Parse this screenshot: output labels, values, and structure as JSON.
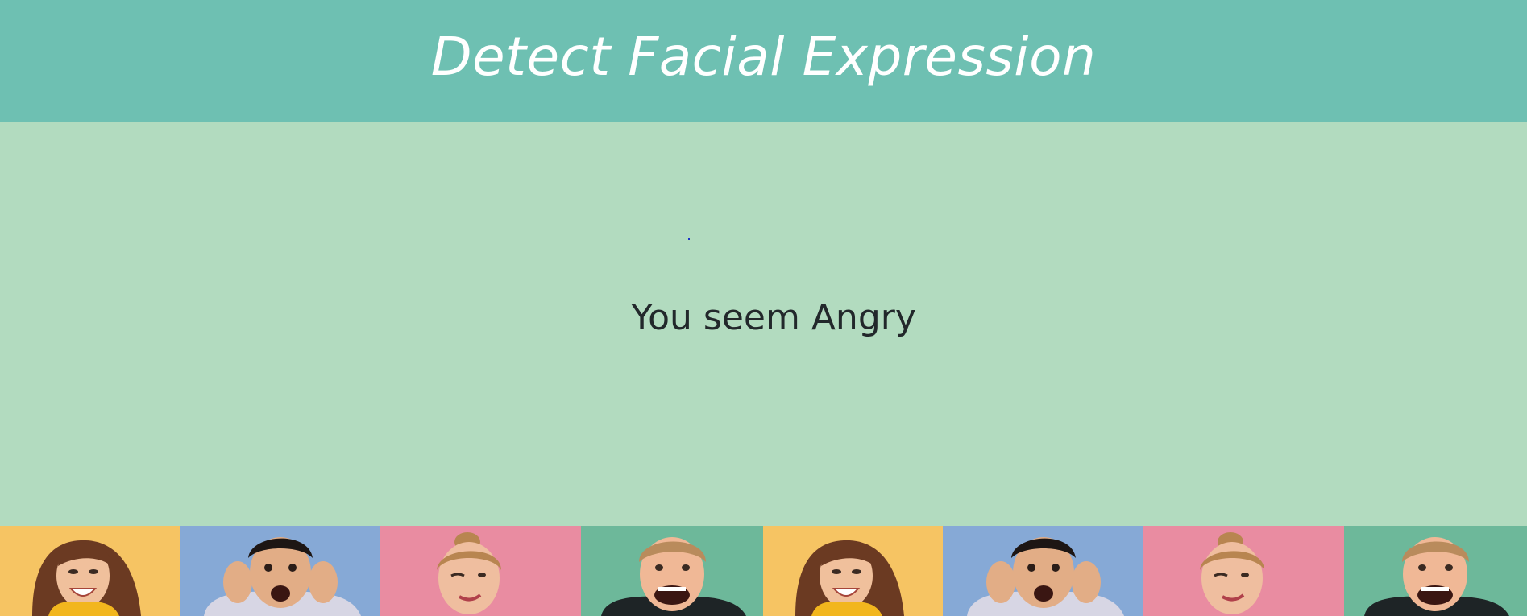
{
  "header": {
    "title": "Detect Facial Expression",
    "background": "#6ec0b2",
    "text_color": "#ffffff"
  },
  "main": {
    "background": "#b2dbbf",
    "result_text": "You seem Angry"
  },
  "banner": {
    "tiles": [
      {
        "name": "woman-laughing-yellow",
        "bg": "#f6c463"
      },
      {
        "name": "man-shocked-blue",
        "bg": "#86a9d6"
      },
      {
        "name": "woman-winking-pink",
        "bg": "#e98ca1"
      },
      {
        "name": "man-screaming-green",
        "bg": "#6db89a"
      },
      {
        "name": "woman-laughing-yellow",
        "bg": "#f6c463"
      },
      {
        "name": "man-shocked-blue",
        "bg": "#86a9d6"
      },
      {
        "name": "woman-winking-pink",
        "bg": "#e98ca1"
      },
      {
        "name": "man-screaming-green",
        "bg": "#6db89a"
      }
    ]
  }
}
